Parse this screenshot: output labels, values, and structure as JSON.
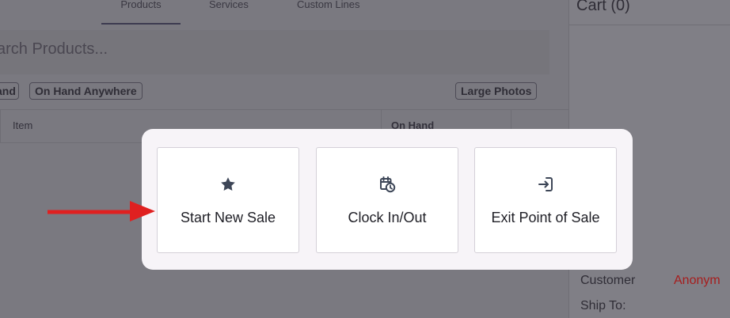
{
  "app": {
    "tabs": [
      {
        "label": "Products"
      },
      {
        "label": "Services"
      },
      {
        "label": "Custom Lines"
      }
    ],
    "search": {
      "placeholder": "arch Products..."
    },
    "filters": {
      "on_hand": "and",
      "on_hand_anywhere": "On Hand Anywhere",
      "large_photos": "Large Photos"
    },
    "table": {
      "item_header": "Item",
      "on_hand_header": "On Hand"
    },
    "cart": {
      "title": "Cart (0)",
      "customer_label": "Customer",
      "customer_value": "Anonym",
      "ship_to_label": "Ship To:"
    }
  },
  "modal": {
    "options": [
      {
        "label": "Start New Sale",
        "icon": "star-icon"
      },
      {
        "label": "Clock In/Out",
        "icon": "calendar-clock-icon"
      },
      {
        "label": "Exit Point of Sale",
        "icon": "exit-icon"
      }
    ]
  },
  "colors": {
    "overlay": "#7b7a81",
    "modal_bg": "#f7f4f8",
    "option_bg": "#ffffff",
    "arrow": "#e02020",
    "anonymous_text": "#a61d1d",
    "icon": "#3d4657"
  }
}
